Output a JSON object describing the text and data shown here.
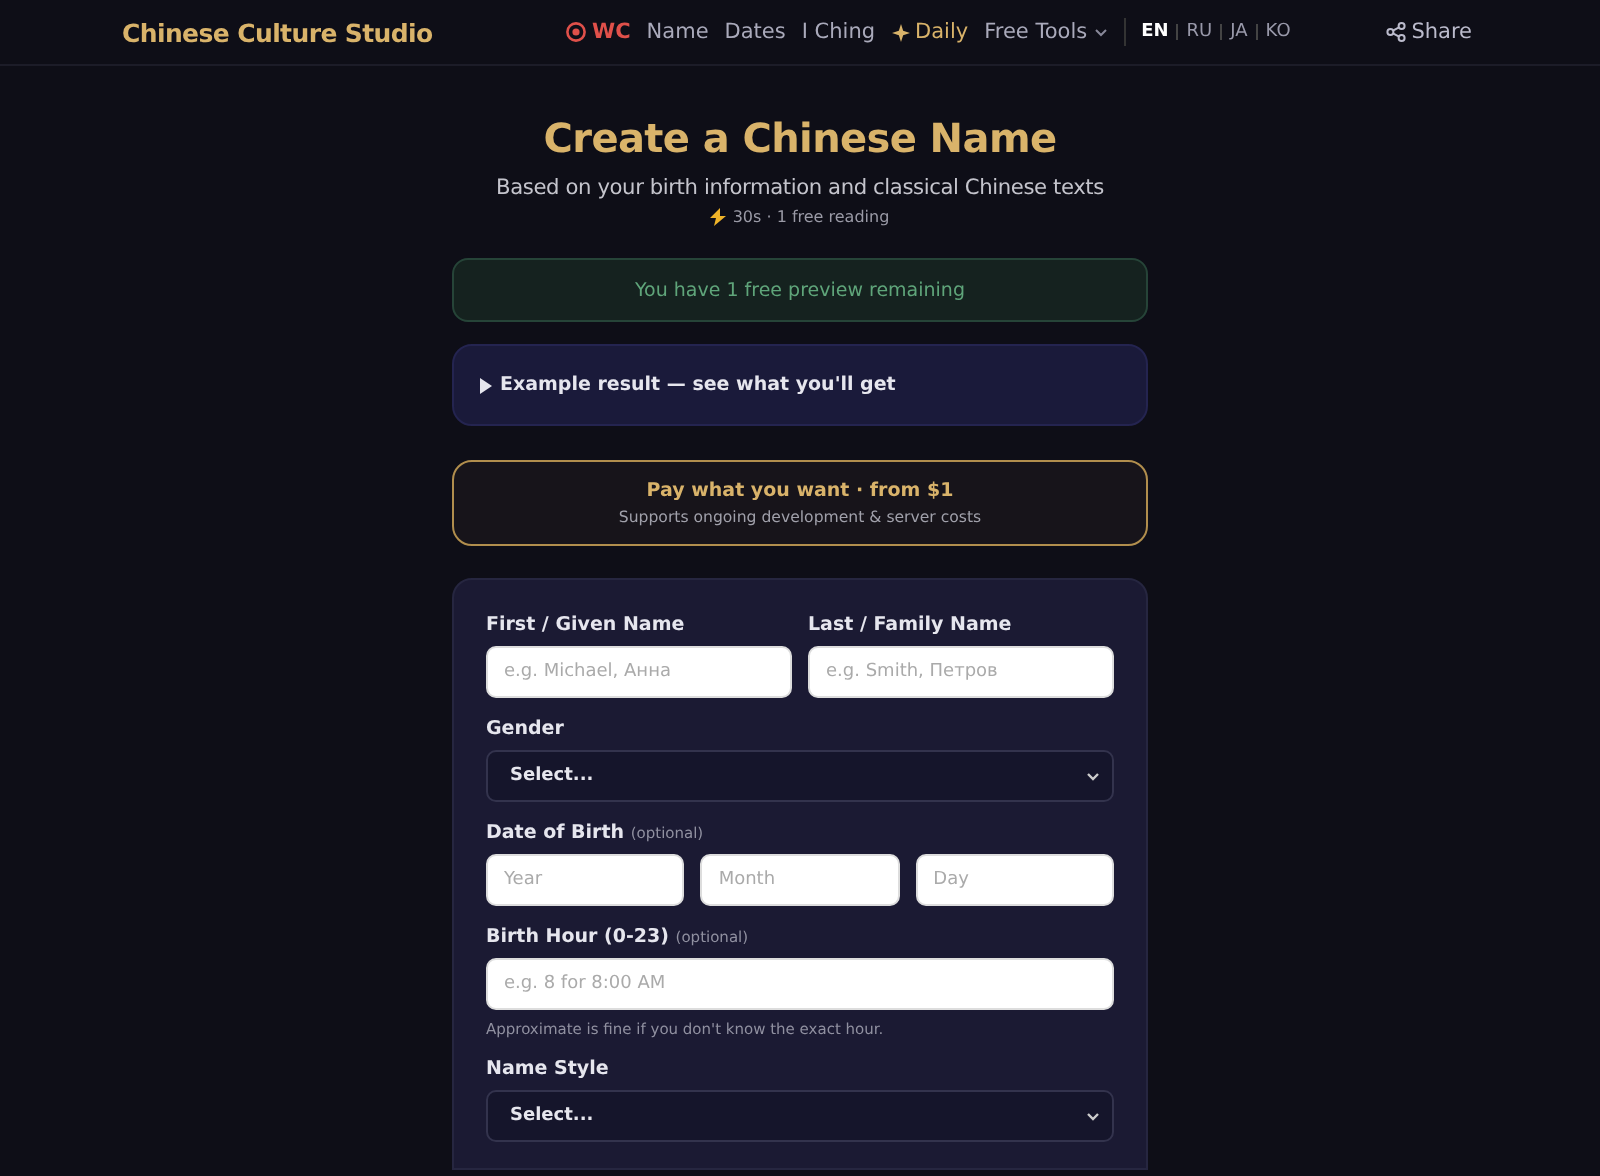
{
  "header": {
    "brand": "Chinese Culture Studio",
    "nav": [
      {
        "kind": "ball",
        "label": "WC"
      },
      {
        "kind": "plain",
        "label": "Name"
      },
      {
        "kind": "plain",
        "label": "Dates"
      },
      {
        "kind": "plain",
        "label": "I Ching"
      },
      {
        "kind": "star",
        "label": "Daily"
      },
      {
        "kind": "dropdown",
        "label": "Free Tools"
      }
    ],
    "languages": [
      {
        "label": "EN",
        "selected": true
      },
      {
        "label": "RU",
        "selected": false
      },
      {
        "label": "JA",
        "selected": false
      },
      {
        "label": "KO",
        "selected": false
      }
    ],
    "share": "Share"
  },
  "hero": {
    "title": "Create a Chinese Name",
    "subtitle": "Based on your birth information and classical Chinese texts",
    "meta": "30s · 1 free reading"
  },
  "notice": "You have 1 free preview remaining",
  "example": {
    "label": "Example result — see what you'll get",
    "expanded": false
  },
  "pricing": {
    "title": "Pay what you want · from $1",
    "subtitle": "Supports ongoing development & server costs"
  },
  "form": [
    {
      "kind": "pair",
      "fields": [
        {
          "label": "First / Given Name",
          "placeholder": "e.g. Michael, Анна"
        },
        {
          "label": "Last / Family Name",
          "placeholder": "e.g. Smith, Петров"
        }
      ]
    },
    {
      "kind": "select",
      "label": "Gender",
      "value": "Select..."
    },
    {
      "kind": "triple",
      "label": "Date of Birth",
      "note": "(optional)",
      "placeholders": [
        "Year",
        "Month",
        "Day"
      ]
    },
    {
      "kind": "text",
      "label": "Birth Hour (0-23)",
      "note": "(optional)",
      "placeholder": "e.g. 8 for 8:00 AM",
      "hint": "Approximate is fine if you don't know the exact hour."
    },
    {
      "kind": "select",
      "label": "Name Style",
      "value": "Select..."
    }
  ]
}
